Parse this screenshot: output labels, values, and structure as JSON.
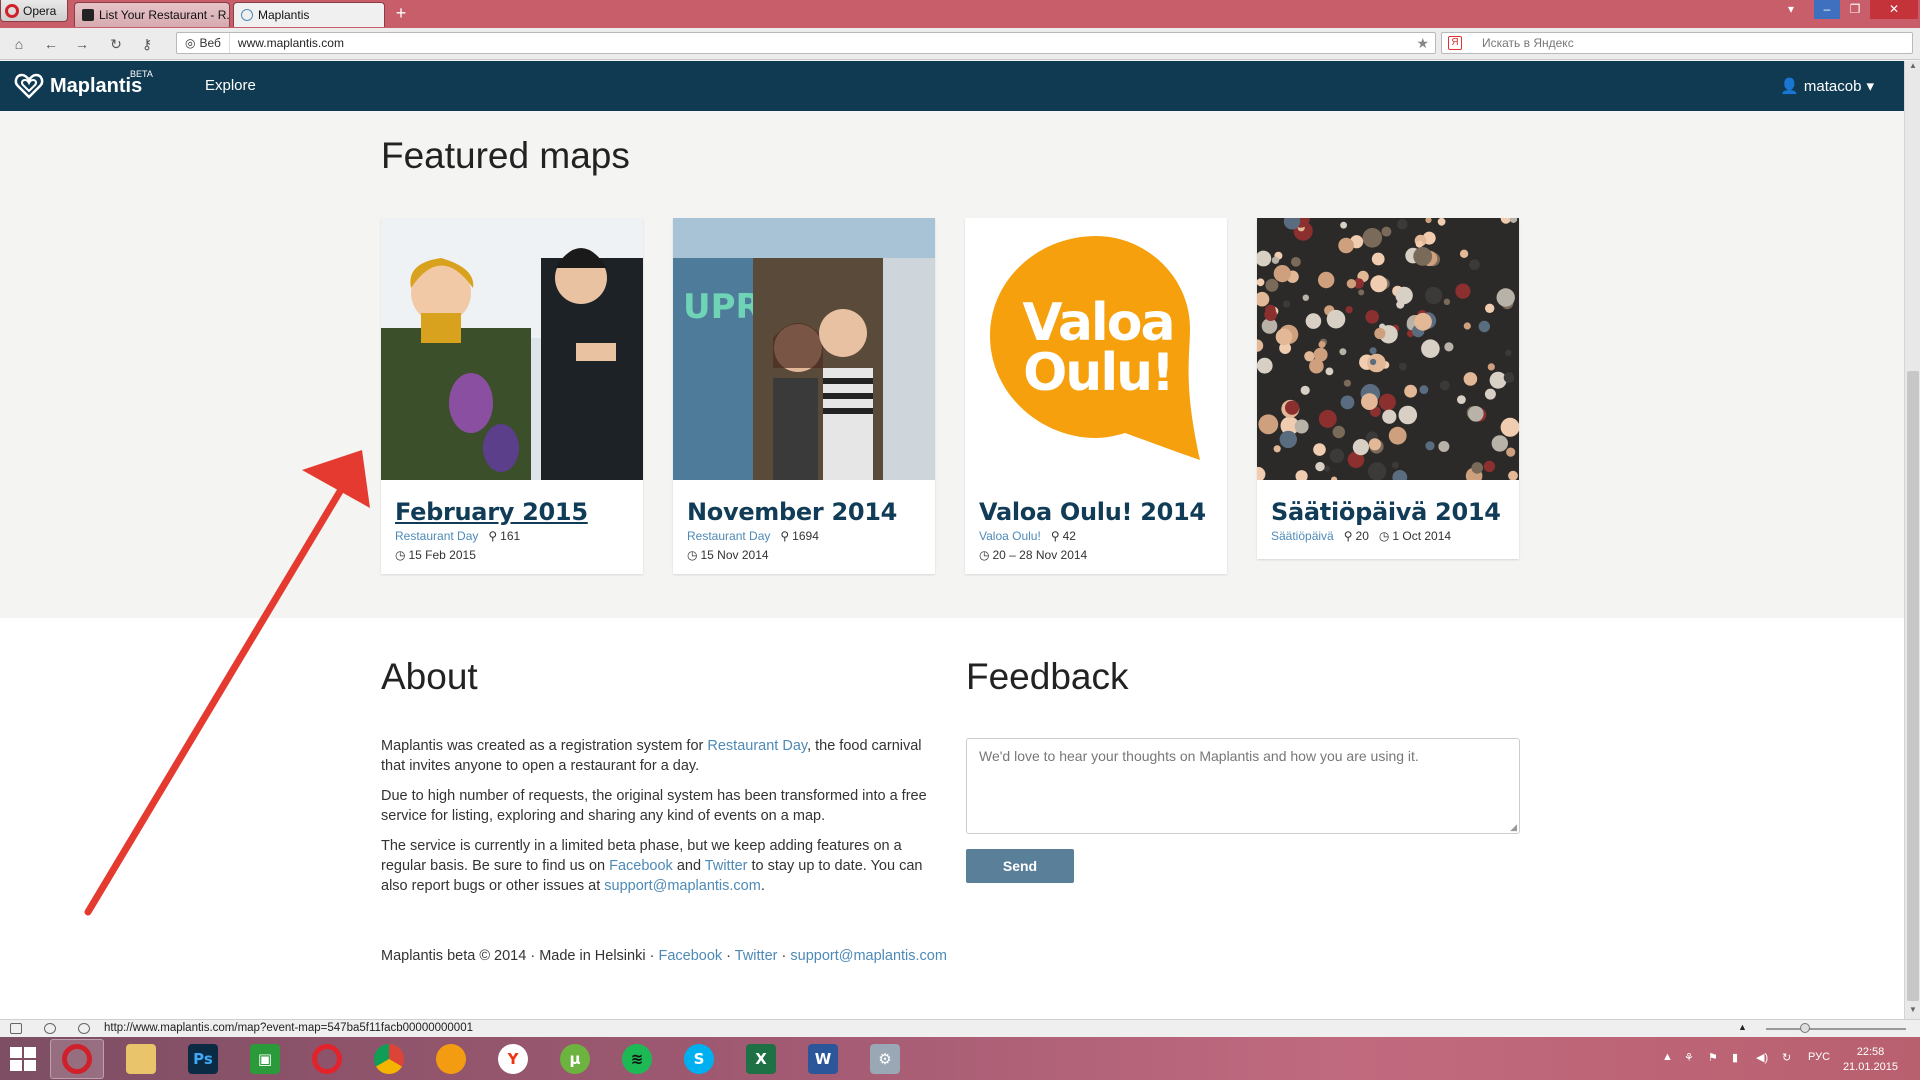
{
  "browser": {
    "opera_label": "Opera",
    "tabs": [
      {
        "label": "List Your Restaurant - R..."
      },
      {
        "label": "Maplantis"
      }
    ],
    "new_tab": "+",
    "address": {
      "prefix": "Веб",
      "url": "www.maplantis.com"
    },
    "search_placeholder": "Искать в Яндекс",
    "status_url": "http://www.maplantis.com/map?event-map=547ba5f11facb00000000001"
  },
  "header": {
    "logo_name": "Maplantis",
    "beta": "BETA",
    "nav_explore": "Explore",
    "user": "matacob"
  },
  "featured": {
    "title": "Featured maps",
    "cards": [
      {
        "title": "February 2015",
        "category": "Restaurant Day",
        "count": "161",
        "date": "15 Feb 2015"
      },
      {
        "title": "November 2014",
        "category": "Restaurant Day",
        "count": "1694",
        "date": "15 Nov 2014"
      },
      {
        "title": "Valoa Oulu! 2014",
        "category": "Valoa Oulu!",
        "count": "42",
        "date": "20 – 28 Nov 2014",
        "logo_line1": "Valoa",
        "logo_line2": "Oulu!"
      },
      {
        "title": "Säätiöpäivä 2014",
        "category": "Säätiöpäivä",
        "count": "20",
        "date": "1 Oct 2014"
      }
    ]
  },
  "about": {
    "title": "About",
    "p1_a": "Maplantis was created as a registration system for ",
    "p1_link": "Restaurant Day",
    "p1_b": ", the food carnival that invites anyone to open a restaurant for a day.",
    "p2": "Due to high number of requests, the original system has been transformed into a free service for listing, exploring and sharing any kind of events on a map.",
    "p3_a": "The service is currently in a limited beta phase, but we keep adding features on a regular basis. Be sure to find us on ",
    "p3_facebook": "Facebook",
    "p3_and": " and ",
    "p3_twitter": "Twitter",
    "p3_b": " to stay up to date. You can also report bugs or other issues at ",
    "p3_email": "support@maplantis.com",
    "p3_end": "."
  },
  "feedback": {
    "title": "Feedback",
    "placeholder": "We'd love to hear your thoughts on Maplantis and how you are using it.",
    "send": "Send"
  },
  "footer": {
    "text": "Maplantis beta © 2014 · Made in Helsinki · ",
    "facebook": "Facebook",
    "sep": " · ",
    "twitter": "Twitter",
    "email": "support@maplantis.com"
  },
  "taskbar": {
    "lang": "РУС",
    "time": "22:58",
    "date": "21.01.2015"
  },
  "colors": {
    "header_bg": "#0f3a52",
    "link": "#4e8ab7",
    "send_btn": "#5a7f99",
    "valoa_orange": "#f5a00c",
    "annotation_arrow": "#e53a2f"
  }
}
